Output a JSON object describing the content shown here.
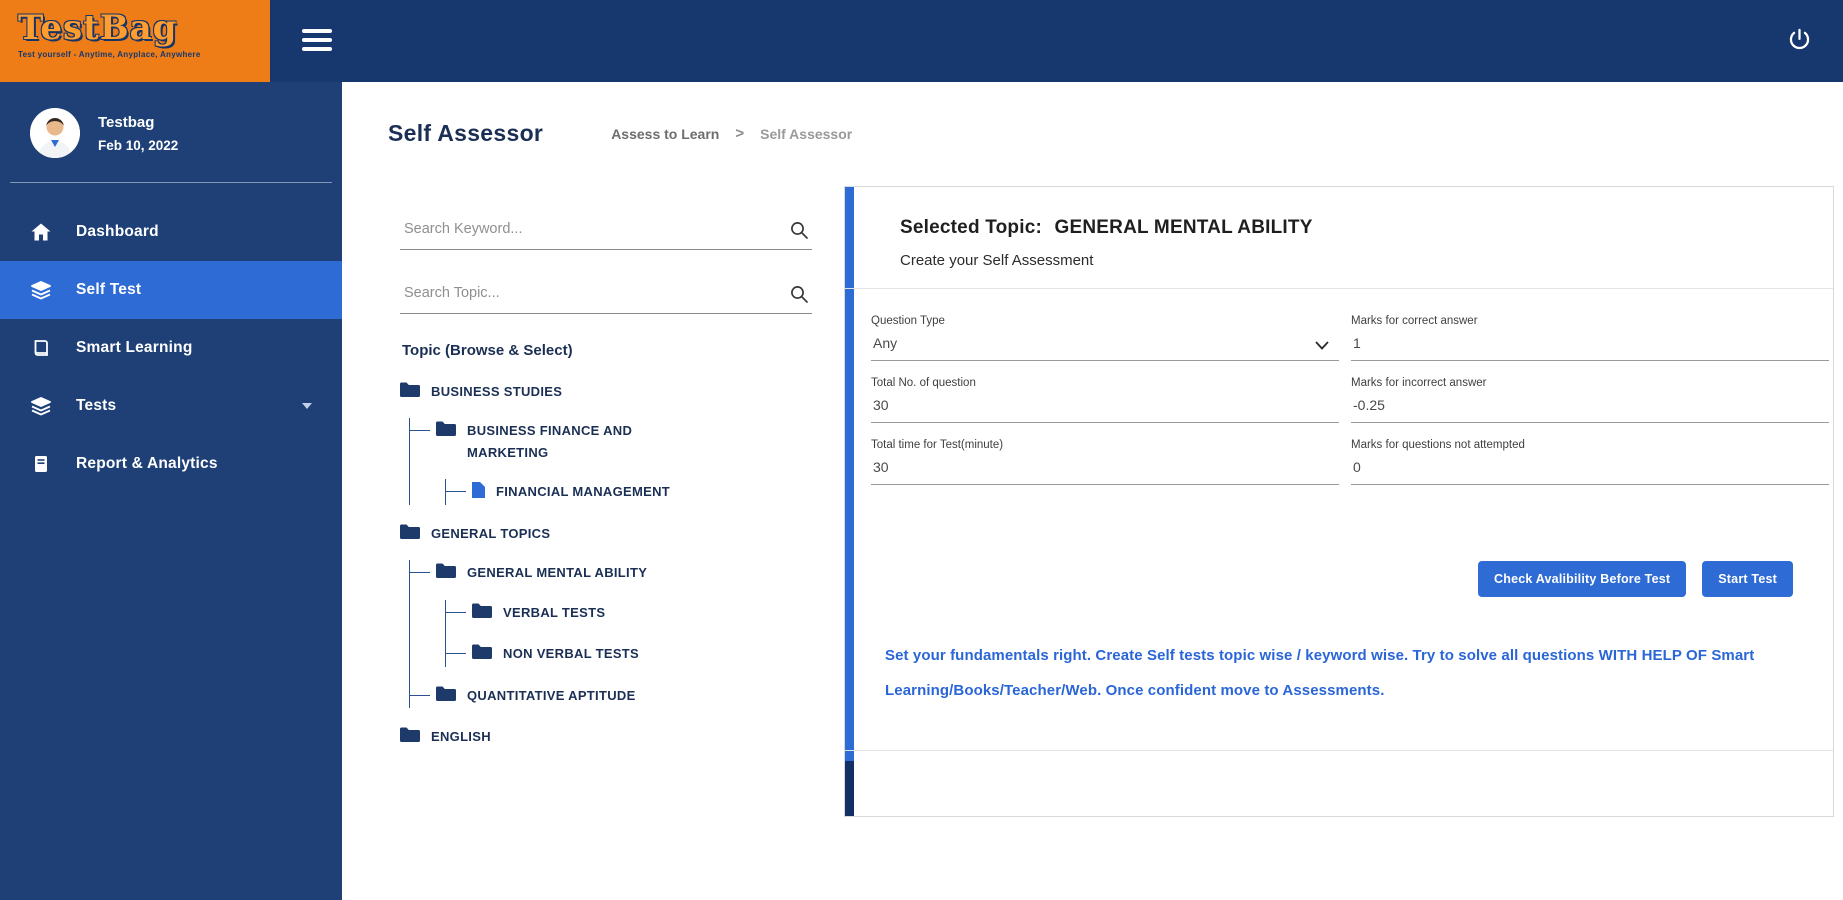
{
  "header": {
    "logo": {
      "title": "TestBag",
      "tagline": "Test yourself - Anytime, Anyplace, Anywhere"
    }
  },
  "sidebar": {
    "profile": {
      "name": "Testbag",
      "date": "Feb 10, 2022"
    },
    "items": [
      {
        "label": "Dashboard",
        "active": false
      },
      {
        "label": "Self Test",
        "active": true
      },
      {
        "label": "Smart Learning",
        "active": false
      },
      {
        "label": "Tests",
        "active": false,
        "has_caret": true
      },
      {
        "label": "Report & Analytics",
        "active": false
      }
    ]
  },
  "page": {
    "title": "Self Assessor",
    "breadcrumb": {
      "parent": "Assess to Learn",
      "separator": ">",
      "current": "Self Assessor"
    }
  },
  "search": {
    "keyword_placeholder": "Search Keyword...",
    "topic_placeholder": "Search Topic..."
  },
  "tree": {
    "heading": "Topic (Browse & Select)",
    "nodes": [
      {
        "label": "BUSINESS STUDIES",
        "type": "folder",
        "level": 0
      },
      {
        "label": "BUSINESS FINANCE AND MARKETING",
        "type": "folder",
        "level": 1
      },
      {
        "label": "FINANCIAL MANAGEMENT",
        "type": "file",
        "level": 2
      },
      {
        "label": "GENERAL TOPICS",
        "type": "folder",
        "level": 0
      },
      {
        "label": "GENERAL MENTAL ABILITY",
        "type": "folder",
        "level": 1
      },
      {
        "label": "VERBAL TESTS",
        "type": "folder",
        "level": 2
      },
      {
        "label": "NON VERBAL TESTS",
        "type": "folder",
        "level": 2
      },
      {
        "label": "QUANTITATIVE APTITUDE",
        "type": "folder",
        "level": 1
      },
      {
        "label": "ENGLISH",
        "type": "folder",
        "level": 0
      }
    ]
  },
  "panel": {
    "selected_topic_label": "Selected Topic:",
    "selected_topic_value": "GENERAL MENTAL ABILITY",
    "subtitle": "Create your Self Assessment",
    "fields": [
      {
        "label": "Question Type",
        "value": "Any",
        "dropdown": true
      },
      {
        "label": "Marks for correct answer",
        "value": "1"
      },
      {
        "label": "Total No. of question",
        "value": "30"
      },
      {
        "label": "Marks for incorrect answer",
        "value": "-0.25"
      },
      {
        "label": "Total time for Test(minute)",
        "value": "30"
      },
      {
        "label": "Marks for questions not attempted",
        "value": "0"
      }
    ],
    "buttons": {
      "check_availability": "Check Avalibility Before Test",
      "start_test": "Start Test"
    },
    "note": "Set your fundamentals right. Create Self tests topic wise / keyword wise. Try to solve all questions WITH HELP OF Smart Learning/Books/Teacher/Web. Once confident move to Assessments."
  },
  "colors": {
    "accent_blue": "#2E6BD4",
    "header_navy": "#16386F",
    "sidebar_navy": "#1E4077",
    "logo_orange": "#EE7D17",
    "note_blue": "#2A66D8",
    "active_item_blue": "#2E6BD4"
  }
}
